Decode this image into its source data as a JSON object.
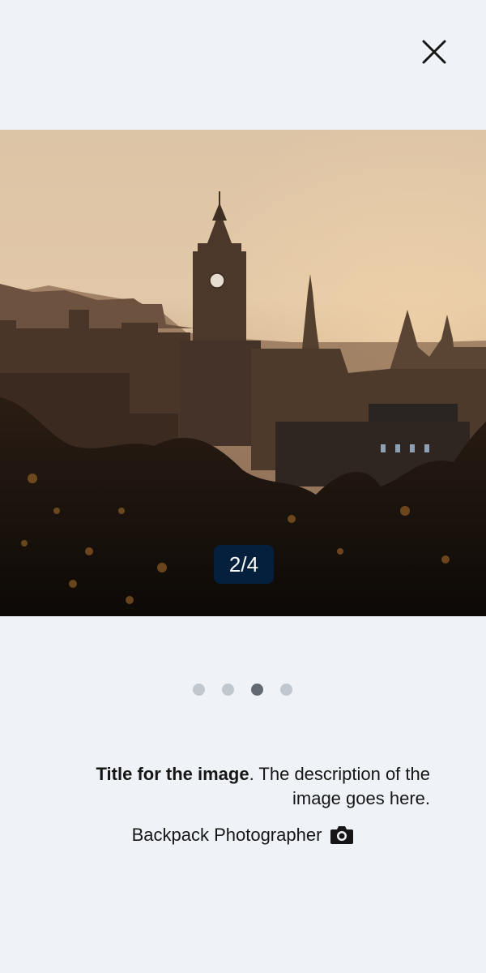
{
  "viewer": {
    "close_icon": "close-icon",
    "counter": "2/4",
    "current_index": 2,
    "total": 4
  },
  "pagination": {
    "dots": [
      {
        "active": false
      },
      {
        "active": false
      },
      {
        "active": true
      },
      {
        "active": false
      }
    ],
    "colors": {
      "active": "#626971",
      "inactive": "#c1c7cf"
    }
  },
  "caption": {
    "title": "Title for the image",
    "description": ". The description of the image goes here."
  },
  "credit": {
    "text": "Backpack Photographer",
    "icon": "camera-icon"
  },
  "colors": {
    "background": "#eff3f7",
    "counter_bg": "#05203c",
    "text": "#161616"
  }
}
